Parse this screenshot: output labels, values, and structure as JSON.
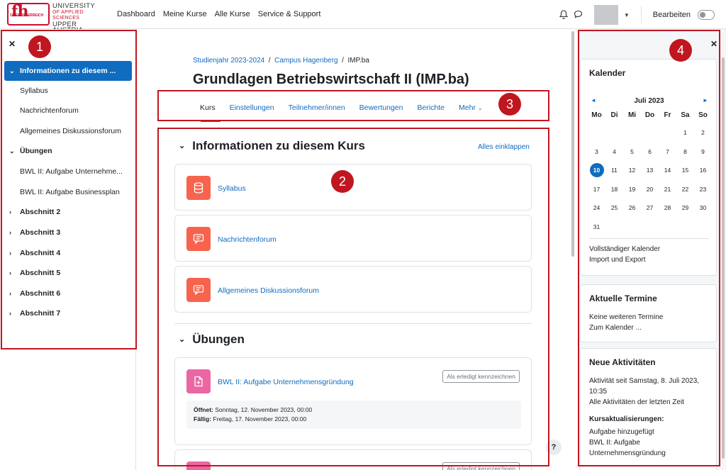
{
  "navbar": {
    "logo": {
      "mark": "fh",
      "sub": "OBERÖSTERREICH",
      "line1": "UNIVERSITY",
      "line2": "OF APPLIED SCIENCES",
      "line3": "UPPER AUSTRIA"
    },
    "links": [
      "Dashboard",
      "Meine Kurse",
      "Alle Kurse",
      "Service & Support"
    ],
    "edit_label": "Bearbeiten"
  },
  "left_drawer": {
    "items": [
      {
        "label": "Informationen zu diesem ...",
        "type": "section",
        "active": true
      },
      {
        "label": "Syllabus",
        "type": "activity"
      },
      {
        "label": "Nachrichtenforum",
        "type": "activity"
      },
      {
        "label": "Allgemeines Diskussionsforum",
        "type": "activity"
      },
      {
        "label": "Übungen",
        "type": "section"
      },
      {
        "label": "BWL II: Aufgabe Unternehme...",
        "type": "activity"
      },
      {
        "label": "BWL II: Aufgabe Businessplan",
        "type": "activity"
      },
      {
        "label": "Abschnitt 2",
        "type": "section"
      },
      {
        "label": "Abschnitt 3",
        "type": "section"
      },
      {
        "label": "Abschnitt 4",
        "type": "section"
      },
      {
        "label": "Abschnitt 5",
        "type": "section"
      },
      {
        "label": "Abschnitt 6",
        "type": "section"
      },
      {
        "label": "Abschnitt 7",
        "type": "section"
      }
    ]
  },
  "annotations": [
    "1",
    "2",
    "3",
    "4"
  ],
  "main": {
    "breadcrumb": [
      "Studienjahr 2023-2024",
      "Campus Hagenberg",
      "IMP.ba"
    ],
    "title": "Grundlagen Betriebswirtschaft II (IMP.ba)",
    "tabs": [
      "Kurs",
      "Einstellungen",
      "Teilnehmer/innen",
      "Bewertungen",
      "Berichte",
      "Mehr"
    ],
    "collapse_all": "Alles einklappen",
    "section1": {
      "title": "Informationen zu diesem Kurs",
      "activities": [
        "Syllabus",
        "Nachrichtenforum",
        "Allgemeines Diskussionsforum"
      ]
    },
    "section2": {
      "title": "Übungen",
      "assignment": {
        "title": "BWL II: Aufgabe Unternehmensgründung",
        "done_label": "Als erledigt kennzeichnen",
        "opens_label": "Öffnet:",
        "opens": "Sonntag, 12. November 2023, 00:00",
        "due_label": "Fällig:",
        "due": "Freitag, 17. November 2023, 00:00"
      },
      "next_done_label": "Als erledigt kennzeichnen"
    },
    "help": "?"
  },
  "colors": {
    "brand": "#0f6cbf",
    "annotation": "#c0161f",
    "resource_icon": "#f7634d",
    "assign_icon": "#eb66a2"
  },
  "calendar": {
    "title": "Kalender",
    "month": "Juli 2023",
    "prev": "◄",
    "next": "►",
    "weekdays": [
      "Mo",
      "Di",
      "Mi",
      "Do",
      "Fr",
      "Sa",
      "So"
    ],
    "days": [
      "",
      "",
      "",
      "",
      "",
      "1",
      "2",
      "3",
      "4",
      "5",
      "6",
      "7",
      "8",
      "9",
      "10",
      "11",
      "12",
      "13",
      "14",
      "15",
      "16",
      "17",
      "18",
      "19",
      "20",
      "21",
      "22",
      "23",
      "24",
      "25",
      "26",
      "27",
      "28",
      "29",
      "30",
      "31"
    ],
    "today": "10",
    "full_link": "Vollständiger Kalender",
    "export_link": "Import und Export"
  },
  "upcoming": {
    "title": "Aktuelle Termine",
    "text": "Keine weiteren Termine",
    "link": "Zum Kalender ..."
  },
  "recent": {
    "title": "Neue Aktivitäten",
    "since": "Aktivität seit Samstag, 8. Juli 2023, 10:35",
    "link": "Alle Aktivitäten der letzten Zeit",
    "updates_title": "Kursaktualisierungen:",
    "added": "Aufgabe hinzugefügt",
    "item": "BWL II: Aufgabe Unternehmensgründung"
  }
}
